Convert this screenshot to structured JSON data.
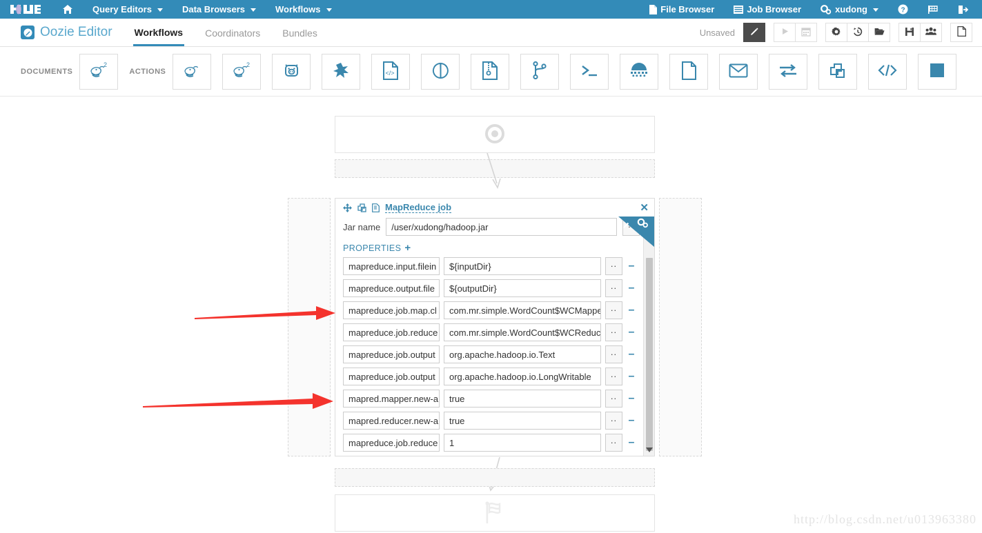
{
  "topnav": {
    "logo": "Hue",
    "items": [
      {
        "label": "",
        "icon": "home-icon"
      },
      {
        "label": "Query Editors",
        "icon": "chevron-down-icon"
      },
      {
        "label": "Data Browsers",
        "icon": "chevron-down-icon"
      },
      {
        "label": "Workflows",
        "icon": "chevron-down-icon"
      }
    ],
    "right": [
      {
        "label": "File Browser",
        "icon": "file-icon"
      },
      {
        "label": "Job Browser",
        "icon": "list-icon"
      },
      {
        "label": "xudong",
        "icon": "gears-icon"
      },
      {
        "label": "",
        "icon": "help-icon"
      },
      {
        "label": "",
        "icon": "flag-icon"
      },
      {
        "label": "",
        "icon": "logout-icon"
      }
    ]
  },
  "subbar": {
    "app_title": "Oozie Editor",
    "app_badge_icon": "pencil-circle-icon",
    "tabs": [
      {
        "label": "Workflows",
        "active": true
      },
      {
        "label": "Coordinators",
        "active": false
      },
      {
        "label": "Bundles",
        "active": false
      }
    ],
    "status": "Unsaved",
    "buttons": [
      {
        "name": "edit-button",
        "icon": "pencil-icon",
        "state": "active"
      },
      {
        "name": "run-button",
        "icon": "play-icon",
        "state": "disabled"
      },
      {
        "name": "schedule-button",
        "icon": "calendar-icon",
        "state": "disabled"
      },
      {
        "name": "settings-button",
        "icon": "gear-icon",
        "state": "normal"
      },
      {
        "name": "history-button",
        "icon": "history-icon",
        "state": "normal"
      },
      {
        "name": "open-button",
        "icon": "folder-open-icon",
        "state": "normal"
      },
      {
        "name": "save-button",
        "icon": "save-icon",
        "state": "normal"
      },
      {
        "name": "share-button",
        "icon": "people-icon",
        "state": "normal"
      },
      {
        "name": "new-button",
        "icon": "new-document-icon",
        "state": "normal"
      }
    ]
  },
  "actionbar": {
    "documents_label": "DOCUMENTS",
    "actions_label": "ACTIONS",
    "documents": [
      {
        "name": "hive2-document-action",
        "icon": "hive-2-icon"
      }
    ],
    "actions": [
      {
        "name": "hive-action",
        "icon": "hive-icon"
      },
      {
        "name": "hive2-action",
        "icon": "hive-2-icon"
      },
      {
        "name": "pig-action",
        "icon": "pig-icon"
      },
      {
        "name": "spark-action",
        "icon": "spark-icon"
      },
      {
        "name": "java-action",
        "icon": "code-file-icon"
      },
      {
        "name": "sqoop-action",
        "icon": "sqoop-circle-icon"
      },
      {
        "name": "distcp-action",
        "icon": "zip-file-icon"
      },
      {
        "name": "fork-action",
        "icon": "fork-icon"
      },
      {
        "name": "shell-action",
        "icon": "terminal-icon"
      },
      {
        "name": "mapreduce-action",
        "icon": "mapreduce-icon"
      },
      {
        "name": "fs-action",
        "icon": "document-icon"
      },
      {
        "name": "email-action",
        "icon": "envelope-icon"
      },
      {
        "name": "streaming-action",
        "icon": "exchange-icon"
      },
      {
        "name": "subworkflow-action",
        "icon": "copy-icon"
      },
      {
        "name": "generic-action",
        "icon": "code-icon"
      },
      {
        "name": "kill-action",
        "icon": "square-icon"
      }
    ]
  },
  "workflow": {
    "start_node": {
      "name": "start-node",
      "icon": "start-circle-icon"
    },
    "end_node": {
      "name": "end-node",
      "icon": "checkered-flag-icon"
    },
    "mapreduce_node": {
      "title": "MapReduce job",
      "head_icons": [
        "move-icon",
        "copy-icon",
        "document-icon"
      ],
      "close_label": "✕",
      "corner_icons": [
        "pencil-icon",
        "gears-icon"
      ],
      "jar_label": "Jar name",
      "jar_value": "/user/xudong/hadoop.jar",
      "browse_label": "..",
      "properties_label": "PROPERTIES",
      "add_property_label": "+",
      "remove_label": "–",
      "properties": [
        {
          "name": "mapreduce.input.filein",
          "value": "${inputDir}"
        },
        {
          "name": "mapreduce.output.file",
          "value": "${outputDir}"
        },
        {
          "name": "mapreduce.job.map.cl",
          "value": "com.mr.simple.WordCount$WCMappe"
        },
        {
          "name": "mapreduce.job.reduce",
          "value": "com.mr.simple.WordCount$WCReduce"
        },
        {
          "name": "mapreduce.job.output",
          "value": "org.apache.hadoop.io.Text"
        },
        {
          "name": "mapreduce.job.output",
          "value": "org.apache.hadoop.io.LongWritable"
        },
        {
          "name": "mapred.mapper.new-a",
          "value": "true"
        },
        {
          "name": "mapred.reducer.new-a",
          "value": "true"
        },
        {
          "name": "mapreduce.job.reduce",
          "value": "1"
        }
      ]
    }
  },
  "annotations": {
    "arrow_1": "red-arrow-pointing-to-jar-name",
    "arrow_2": "red-arrow-pointing-to-mapper-class"
  },
  "watermark": "http://blog.csdn.net/u013963380",
  "colors": {
    "nav_bg": "#338bb8",
    "accent": "#3a87ad",
    "annotation_red": "#f4332d"
  }
}
